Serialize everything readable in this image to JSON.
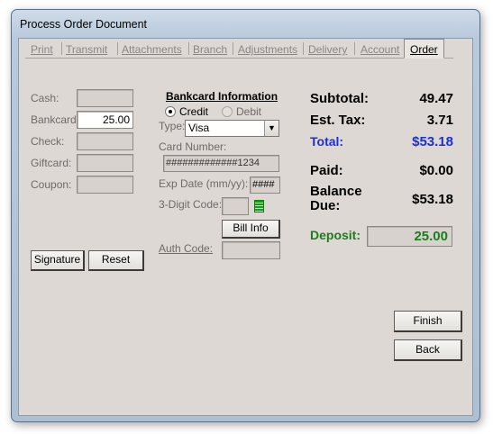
{
  "window": {
    "title": "Process Order Document"
  },
  "tabs": [
    "Print",
    "Transmit",
    "Attachments",
    "Branch",
    "Adjustments",
    "Delivery",
    "Account",
    "Order"
  ],
  "payments": {
    "cash_label": "Cash:",
    "bankcard_label": "Bankcard:",
    "bankcard_value": "25.00",
    "check_label": "Check:",
    "giftcard_label": "Giftcard:",
    "coupon_label": "Coupon:"
  },
  "buttons": {
    "signature": "Signature",
    "reset": "Reset",
    "bill_info": "Bill Info",
    "finish": "Finish",
    "back": "Back"
  },
  "bankcard": {
    "title": "Bankcard Information",
    "credit_label": "Credit",
    "debit_label": "Debit",
    "selected": "Credit",
    "type_label": "Type:",
    "type_value": "Visa",
    "card_number_label": "Card Number:",
    "card_number_value": "#############1234",
    "exp_label": "Exp Date (mm/yy):",
    "exp_value": "####",
    "cvv_label": "3-Digit Code:",
    "cvv_value": "",
    "auth_label": "Auth Code:",
    "auth_value": ""
  },
  "summary": {
    "subtotal_label": "Subtotal:",
    "subtotal_value": "49.47",
    "tax_label": "Est. Tax:",
    "tax_value": "3.71",
    "total_label": "Total:",
    "total_value": "$53.18",
    "paid_label": "Paid:",
    "paid_value": "$0.00",
    "balance_label_1": "Balance",
    "balance_label_2": "Due:",
    "balance_value": "$53.18",
    "deposit_label": "Deposit:",
    "deposit_value": "25.00"
  },
  "colors": {
    "total": "#1b2fd8",
    "deposit": "#1c7d1c",
    "panel": "#ddd8d3"
  }
}
